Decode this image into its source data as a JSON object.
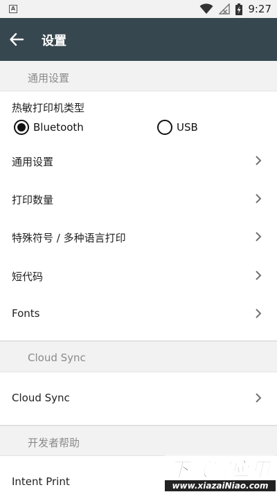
{
  "status_bar": {
    "badge": "A",
    "time": "9:27",
    "icons": [
      "wifi-icon",
      "no-signal-icon",
      "battery-charging-icon"
    ]
  },
  "app_bar": {
    "title": "设置",
    "back_icon": "arrow-left-icon"
  },
  "sections": {
    "general": {
      "header": "通用设置",
      "printer_type_label": "热敏打印机类型",
      "radio_options": [
        {
          "label": "Bluetooth",
          "checked": true
        },
        {
          "label": "USB",
          "checked": false
        }
      ],
      "items": [
        {
          "label": "通用设置"
        },
        {
          "label": "打印数量"
        },
        {
          "label": "特殊符号 / 多种语言打印"
        },
        {
          "label": "短代码"
        },
        {
          "label": "Fonts"
        }
      ]
    },
    "cloud_sync": {
      "header": "Cloud Sync",
      "items": [
        {
          "label": "Cloud Sync"
        }
      ]
    },
    "developer": {
      "header": "开发者帮助",
      "items": [
        {
          "label": "Intent Print"
        }
      ]
    }
  },
  "watermark": {
    "title": "下载写应用",
    "url": "www.xiazaiNiao.com"
  },
  "colors": {
    "app_bar": "#37474f",
    "section_bg": "#f2f2f2",
    "section_text": "#8a8a8a"
  }
}
